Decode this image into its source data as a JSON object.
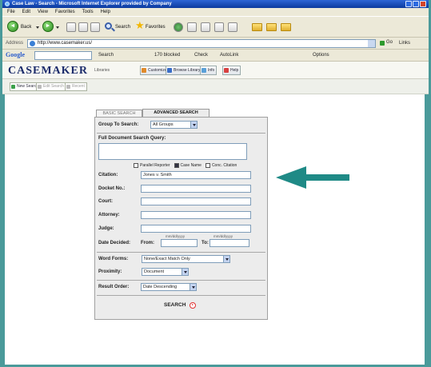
{
  "window": {
    "title": "Case Law - Search - Microsoft Internet Explorer provided by Company"
  },
  "menu": {
    "items": [
      "File",
      "Edit",
      "View",
      "Favorites",
      "Tools",
      "Help"
    ]
  },
  "toolbar": {
    "back": "Back",
    "search": "Search",
    "favorites": "Favorites"
  },
  "address": {
    "label": "Address",
    "url": "http://www.casemaker.us/",
    "go": "Go",
    "links": "Links"
  },
  "google": {
    "logo": "Google",
    "search": "Search",
    "blocked": "170 blocked",
    "check": "Check",
    "autolink": "AutoLink",
    "options": "Options"
  },
  "casemaker": {
    "logo": "CASEMAKER",
    "sublabel": "Libraries",
    "nav": [
      "Customize",
      "Browse Library",
      "Info",
      "Help"
    ]
  },
  "subnav": {
    "items": [
      "New Search",
      "Edit Search",
      "Recent"
    ]
  },
  "form": {
    "tabs": {
      "basic": "BASIC SEARCH",
      "advanced": "ADVANCED SEARCH"
    },
    "group": {
      "label": "Group To Search:",
      "value": "All Groups"
    },
    "query": {
      "label": "Full Document Search Query:",
      "value": ""
    },
    "options": [
      {
        "label": "Parallel Reporter",
        "checked": false
      },
      {
        "label": "Case Name",
        "checked": true
      },
      {
        "label": "Conc. Citation",
        "checked": false
      }
    ],
    "fields": [
      {
        "label": "Citation:",
        "value": "Jones v. Smith"
      },
      {
        "label": "Docket No.:",
        "value": ""
      },
      {
        "label": "Court:",
        "value": ""
      },
      {
        "label": "Attorney:",
        "value": ""
      },
      {
        "label": "Judge:",
        "value": ""
      }
    ],
    "date": {
      "label": "Date Decided:",
      "from_label": "From:",
      "to_label": "To:",
      "from_hint": "mm/dd/yyyy",
      "to_hint": "mm/dd/yyyy",
      "from_value": "",
      "to_value": ""
    },
    "word_forms": {
      "label": "Word Forms:",
      "value": "None/Exact Match Only"
    },
    "proximity": {
      "label": "Proximity:",
      "value": "Document"
    },
    "result_order": {
      "label": "Result Order:",
      "value": "Date Descending"
    },
    "submit": "SEARCH"
  },
  "annotation": {
    "arrow_color": "#1f8a86",
    "arrow_direction": "left"
  },
  "colors": {
    "frame": "#4a9a9a",
    "title_bar": "#1c4fb0",
    "chrome": "#ece9d8",
    "form_bg": "#ececec",
    "logo": "#1b2b6b"
  }
}
